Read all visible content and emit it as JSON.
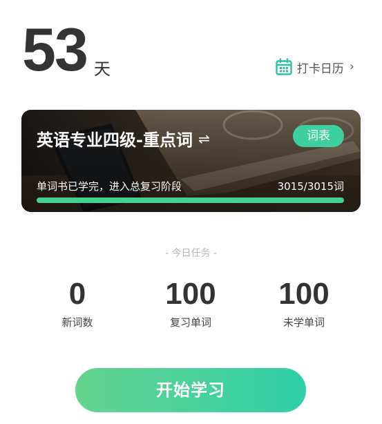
{
  "streak": {
    "days": "53",
    "unit": "天"
  },
  "calendar": {
    "label": "打卡日历",
    "icon": "calendar-icon",
    "chevron": "›",
    "color": "#2fbfa0"
  },
  "book": {
    "title": "英语专业四级-重点词",
    "swap_icon": "⇌",
    "wordlist_label": "词表",
    "status": "单词书已学完，进入总复习阶段",
    "count": "3015/3015词",
    "progress": 1.0,
    "progress_color": "#47d18f",
    "button_color": "#3ecf9e"
  },
  "today": {
    "heading": "- 今日任务 -",
    "stats": [
      {
        "value": "0",
        "label": "新词数"
      },
      {
        "value": "100",
        "label": "复习单词"
      },
      {
        "value": "100",
        "label": "未学单词"
      }
    ]
  },
  "start_button": {
    "label": "开始学习"
  }
}
